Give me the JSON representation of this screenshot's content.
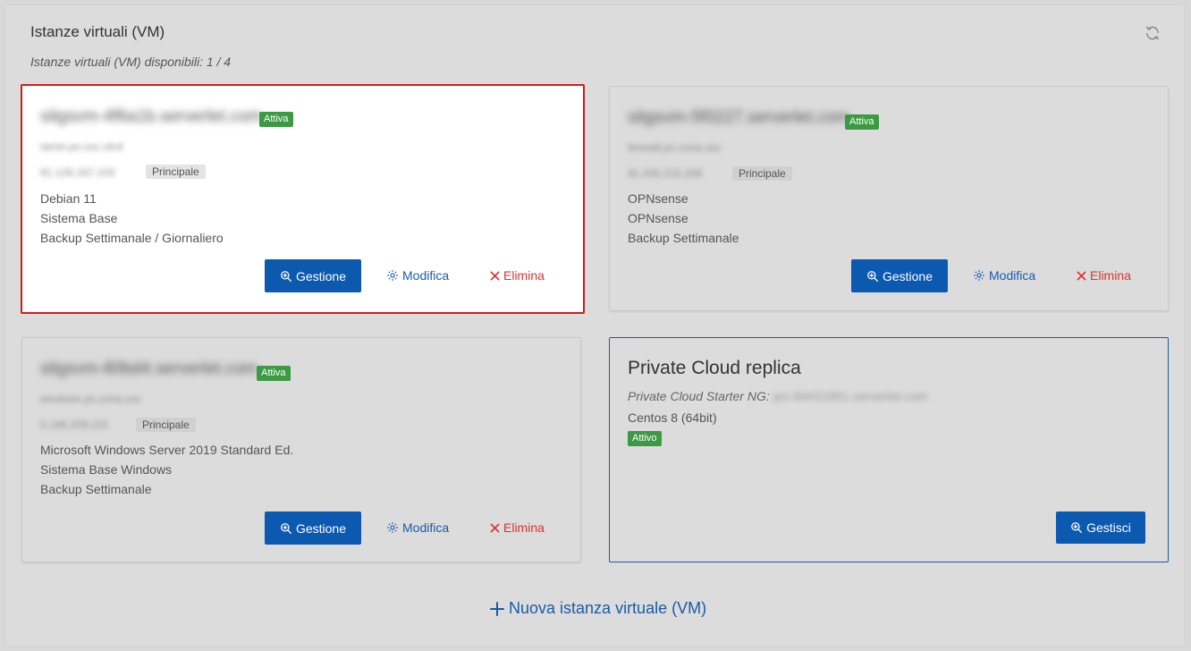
{
  "header": {
    "title": "Istanze virtuali (VM)",
    "availability": "Istanze virtuali (VM) disponibili: 1 / 4"
  },
  "cards": [
    {
      "hostname": "sitgsvm-4f6a1b.serverlet.com",
      "status": "Attiva",
      "sub_line": "tamin.pn.svc.vln4",
      "ip": "91.128.167.103",
      "ip_tag": "Principale",
      "os": "Debian 11",
      "system": "Sistema Base",
      "backup": "Backup Settimanale / Giornaliero",
      "manage_label": "Gestione",
      "edit_label": "Modifica",
      "delete_label": "Elimina"
    },
    {
      "hostname": "sitgsvm-5f0227.serverlet.com",
      "status": "Attiva",
      "sub_line": "firewall.pn.zona.ssv",
      "ip": "91.205.215.206",
      "ip_tag": "Principale",
      "os": "OPNsense",
      "system": "OPNsense",
      "backup": "Backup Settimanale",
      "manage_label": "Gestione",
      "edit_label": "Modifica",
      "delete_label": "Elimina"
    },
    {
      "hostname": "sitgsvm-80bd4.serverlet.com",
      "status": "Attiva",
      "sub_line": "windows.pn.zona.ssv",
      "ip": "5.196.209.231",
      "ip_tag": "Principale",
      "os": "Microsoft Windows Server 2019 Standard Ed.",
      "system": "Sistema Base Windows",
      "backup": "Backup Settimanale",
      "manage_label": "Gestione",
      "edit_label": "Modifica",
      "delete_label": "Elimina"
    }
  ],
  "private_cloud": {
    "title": "Private Cloud replica",
    "plan_label": "Private Cloud Starter NG:",
    "plan_host": "pcr.84431891.serverlet.com",
    "os": "Centos 8 (64bit)",
    "status": "Attivo",
    "manage_label": "Gestisci"
  },
  "new_vm_label": "Nuova istanza virtuale (VM)",
  "colors": {
    "primary": "#0c59b0",
    "success": "#3c9a43",
    "danger": "#d33333",
    "selected_border": "#d01c1c"
  },
  "icons": {
    "refresh": "refresh-icon",
    "manage": "zoom-in-icon",
    "edit": "gear-icon",
    "delete": "close-icon",
    "add": "plus-icon"
  }
}
